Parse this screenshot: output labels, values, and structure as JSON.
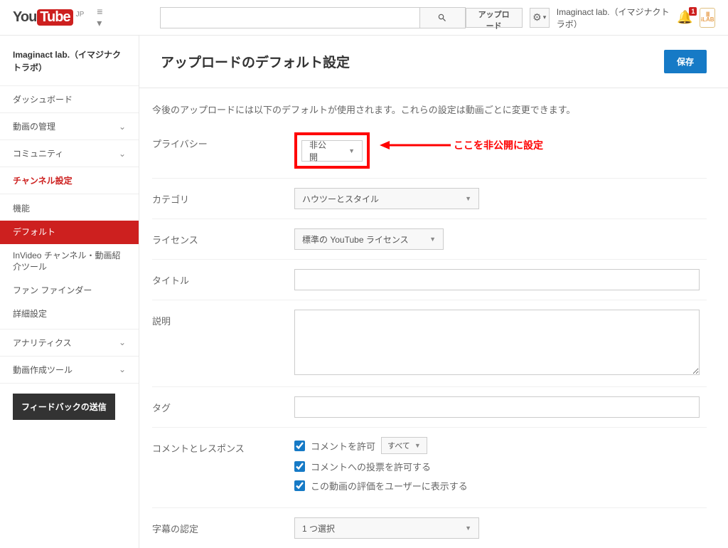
{
  "header": {
    "logo_you": "You",
    "logo_tube": "Tube",
    "region": "JP",
    "upload_label": "アップロード",
    "account_name": "Imaginact lab.（イマジナクトラボ）",
    "notification_count": "1",
    "lab_text": "iLAB"
  },
  "sidebar": {
    "channel_name": "Imaginact lab.（イマジナクトラボ）",
    "items": [
      {
        "label": "ダッシュボード",
        "expandable": false
      },
      {
        "label": "動画の管理",
        "expandable": true
      },
      {
        "label": "コミュニティ",
        "expandable": true
      },
      {
        "label": "チャンネル設定",
        "expandable": false,
        "active": true
      }
    ],
    "sub_items": [
      {
        "label": "機能"
      },
      {
        "label": "デフォルト",
        "selected": true
      },
      {
        "label": "InVideo チャンネル・動画紹介ツール"
      },
      {
        "label": "ファン ファインダー"
      },
      {
        "label": "詳細設定"
      }
    ],
    "lower_items": [
      {
        "label": "アナリティクス",
        "expandable": true
      },
      {
        "label": "動画作成ツール",
        "expandable": true
      }
    ],
    "feedback_label": "フィードバックの送信"
  },
  "main": {
    "title": "アップロードのデフォルト設定",
    "save_label": "保存",
    "intro": "今後のアップロードには以下のデフォルトが使用されます。これらの設定は動画ごとに変更できます。",
    "annotation": "ここを非公開に設定",
    "labels": {
      "privacy": "プライバシー",
      "category": "カテゴリ",
      "license": "ライセンス",
      "title": "タイトル",
      "description": "説明",
      "tags": "タグ",
      "comments": "コメントとレスポンス",
      "captions": "字幕の認定"
    },
    "values": {
      "privacy": "非公開",
      "category": "ハウツーとスタイル",
      "license": "標準の YouTube ライセンス",
      "comment_allow": "コメントを許可",
      "comment_scope": "すべて",
      "comment_vote": "コメントへの投票を許可する",
      "comment_rating": "この動画の評価をユーザーに表示する",
      "captions_select": "1 つ選択"
    }
  }
}
